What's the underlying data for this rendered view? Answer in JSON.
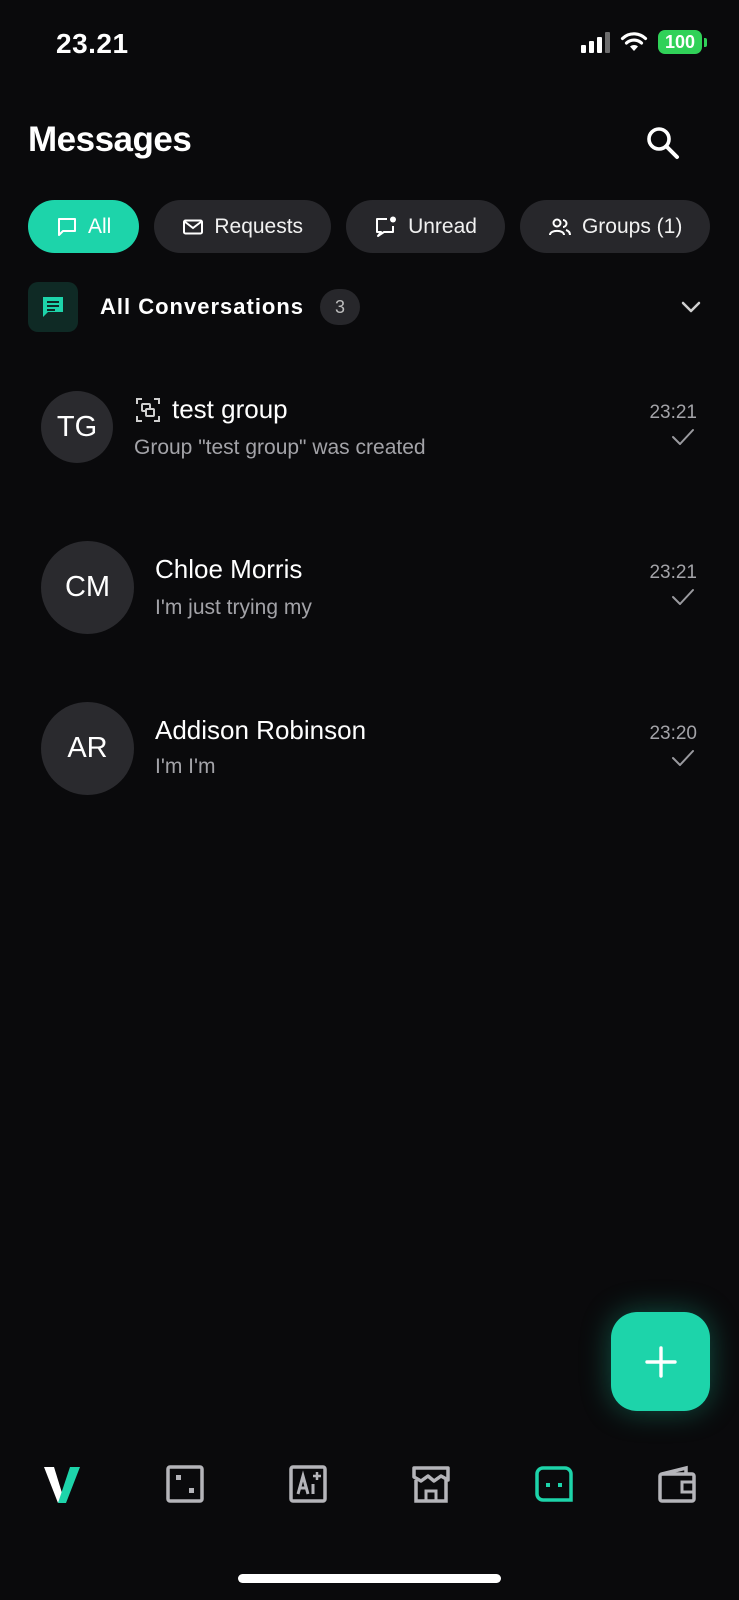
{
  "status_bar": {
    "time": "23.21",
    "battery": "100"
  },
  "header": {
    "title": "Messages"
  },
  "filters": [
    {
      "label": "All",
      "icon": "chat-bubble-icon",
      "active": true
    },
    {
      "label": "Requests",
      "icon": "envelope-icon",
      "active": false
    },
    {
      "label": "Unread",
      "icon": "unread-bubble-icon",
      "active": false
    },
    {
      "label": "Groups (1)",
      "icon": "people-icon",
      "active": false
    }
  ],
  "section": {
    "title": "All Conversations",
    "count": "3"
  },
  "conversations": [
    {
      "initials": "TG",
      "name": "test group",
      "is_group": true,
      "preview": "Group \"test group\" was created",
      "time": "23:21",
      "status": "sent"
    },
    {
      "initials": "CM",
      "name": "Chloe Morris",
      "is_group": false,
      "preview": "I'm just trying my",
      "time": "23:21",
      "status": "sent"
    },
    {
      "initials": "AR",
      "name": "Addison Robinson",
      "is_group": false,
      "preview": "I'm I'm",
      "time": "23:20",
      "status": "sent"
    }
  ],
  "bottom_nav": [
    {
      "name": "home",
      "icon": "app-logo-icon",
      "active": false
    },
    {
      "name": "games",
      "icon": "dice-icon",
      "active": false
    },
    {
      "name": "ai",
      "icon": "ai-icon",
      "active": false
    },
    {
      "name": "store",
      "icon": "store-icon",
      "active": false
    },
    {
      "name": "messages",
      "icon": "message-icon",
      "active": true
    },
    {
      "name": "wallet",
      "icon": "wallet-icon",
      "active": false
    }
  ],
  "colors": {
    "accent": "#1dd4aa",
    "background": "#0a0a0c",
    "chip": "#27272b",
    "muted_text": "#a3a3a8"
  }
}
